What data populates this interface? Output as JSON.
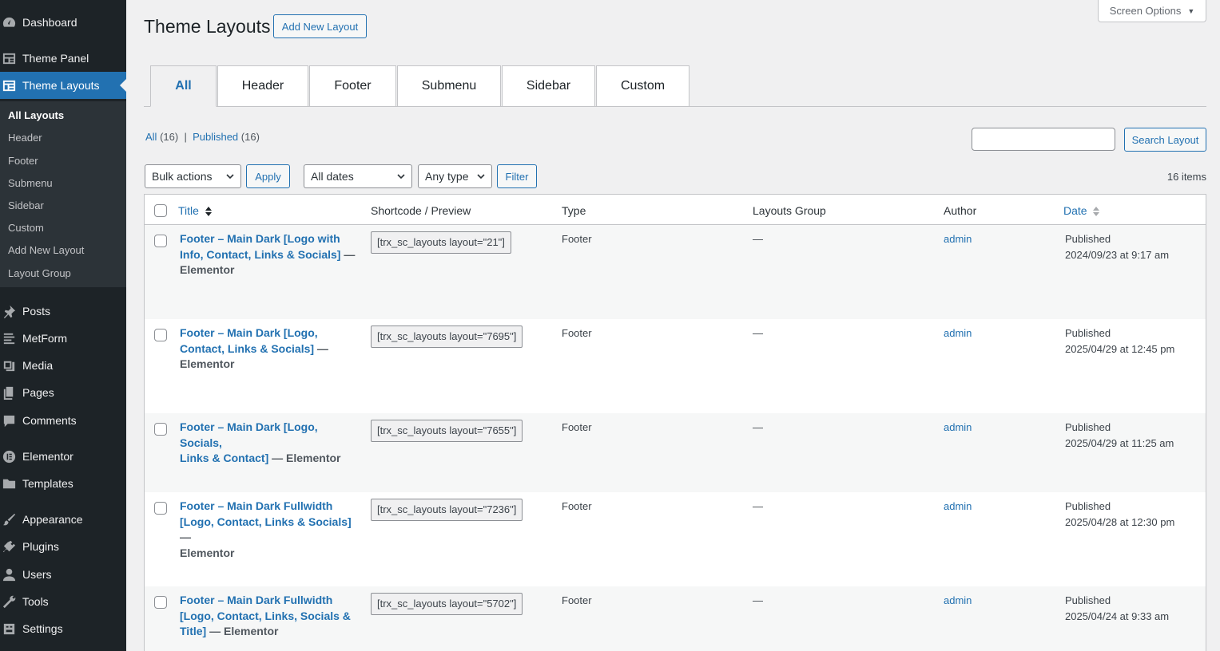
{
  "sidebar": {
    "top_items": [
      {
        "label": "Dashboard",
        "icon": "dashboard-icon"
      },
      {
        "label": "Theme Panel",
        "icon": "theme-panel-icon"
      },
      {
        "label": "Theme Layouts",
        "icon": "theme-layouts-icon"
      }
    ],
    "submenu": [
      "All Layouts",
      "Header",
      "Footer",
      "Submenu",
      "Sidebar",
      "Custom",
      "Add New Layout",
      "Layout Group"
    ],
    "items": [
      {
        "label": "Posts",
        "icon": "pin-icon"
      },
      {
        "label": "MetForm",
        "icon": "form-icon"
      },
      {
        "label": "Media",
        "icon": "media-icon"
      },
      {
        "label": "Pages",
        "icon": "pages-icon"
      },
      {
        "label": "Comments",
        "icon": "comment-icon"
      },
      {
        "label": "Elementor",
        "icon": "elementor-icon"
      },
      {
        "label": "Templates",
        "icon": "folder-icon"
      },
      {
        "label": "Appearance",
        "icon": "brush-icon"
      },
      {
        "label": "Plugins",
        "icon": "plugin-icon"
      },
      {
        "label": "Users",
        "icon": "user-icon"
      },
      {
        "label": "Tools",
        "icon": "wrench-icon"
      },
      {
        "label": "Settings",
        "icon": "settings-icon"
      }
    ]
  },
  "header": {
    "title": "Theme Layouts",
    "add_new": "Add New Layout",
    "screen_options": "Screen Options"
  },
  "tabs": [
    "All",
    "Header",
    "Footer",
    "Submenu",
    "Sidebar",
    "Custom"
  ],
  "views": {
    "all_label": "All",
    "all_count": "(16)",
    "sep": "|",
    "published_label": "Published",
    "published_count": "(16)"
  },
  "search": {
    "button": "Search Layout"
  },
  "filters": {
    "bulk": "Bulk actions",
    "apply": "Apply",
    "dates": "All dates",
    "type": "Any type",
    "filter": "Filter",
    "items_count": "16 items"
  },
  "table": {
    "headers": {
      "title": "Title",
      "shortcode": "Shortcode / Preview",
      "type": "Type",
      "group": "Layouts Group",
      "author": "Author",
      "date": "Date"
    },
    "rows": [
      {
        "title_l1": "Footer – Main Dark [Logo with",
        "title_l2": "Info, Contact, Links & Socials]",
        "title_l2_suffix": " —",
        "title_l3": "Elementor",
        "shortcode": "[trx_sc_layouts layout=\"21\"]",
        "type": "Footer",
        "group": "—",
        "author": "admin",
        "status": "Published",
        "date": "2024/09/23 at 9:17 am"
      },
      {
        "title_l1": "Footer – Main Dark [Logo,",
        "title_l2": "Contact, Links & Socials]",
        "title_l2_suffix": " —",
        "title_l3": "Elementor",
        "shortcode": "[trx_sc_layouts layout=\"7695\"]",
        "type": "Footer",
        "group": "—",
        "author": "admin",
        "status": "Published",
        "date": "2025/04/29 at 12:45 pm"
      },
      {
        "title_l1": "Footer – Main Dark [Logo, Socials,",
        "title_l2": "Links & Contact]",
        "title_l2_suffix": " — Elementor",
        "title_l3": "",
        "shortcode": "[trx_sc_layouts layout=\"7655\"]",
        "type": "Footer",
        "group": "—",
        "author": "admin",
        "status": "Published",
        "date": "2025/04/29 at 11:25 am"
      },
      {
        "title_l1": "Footer – Main Dark Fullwidth",
        "title_l2": "[Logo, Contact, Links & Socials]",
        "title_l2_suffix": " —",
        "title_l3": "Elementor",
        "shortcode": "[trx_sc_layouts layout=\"7236\"]",
        "type": "Footer",
        "group": "—",
        "author": "admin",
        "status": "Published",
        "date": "2025/04/28 at 12:30 pm"
      },
      {
        "title_l1": "Footer – Main Dark Fullwidth",
        "title_l2": "[Logo, Contact, Links, Socials &",
        "title_l2_suffix": "",
        "title_l3": "Title]",
        "title_l3_suffix": " — Elementor",
        "shortcode": "[trx_sc_layouts layout=\"5702\"]",
        "type": "Footer",
        "group": "—",
        "author": "admin",
        "status": "Published",
        "date": "2025/04/24 at 9:33 am"
      }
    ]
  }
}
